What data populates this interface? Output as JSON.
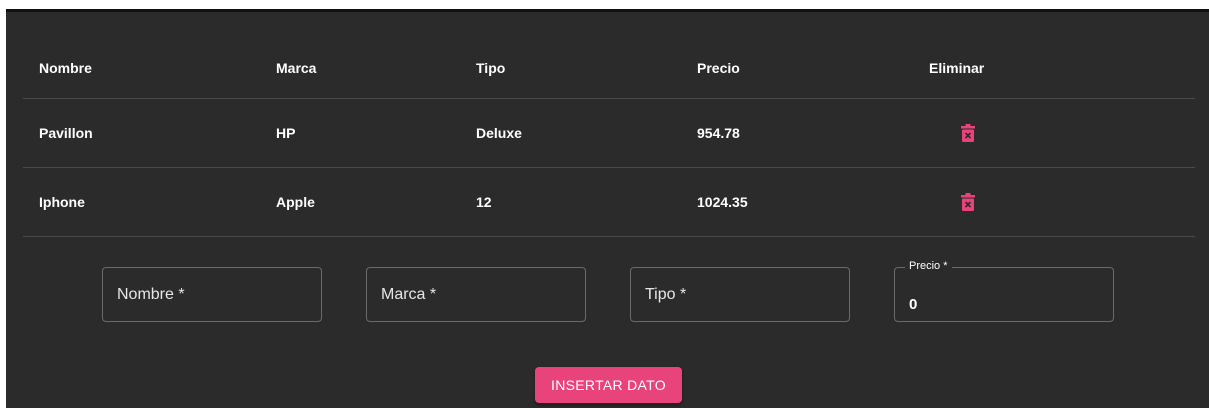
{
  "table": {
    "headers": {
      "nombre": "Nombre",
      "marca": "Marca",
      "tipo": "Tipo",
      "precio": "Precio",
      "eliminar": "Eliminar"
    },
    "rows": [
      {
        "nombre": "Pavillon",
        "marca": "HP",
        "tipo": "Deluxe",
        "precio": "954.78"
      },
      {
        "nombre": "Iphone",
        "marca": "Apple",
        "tipo": "12",
        "precio": "1024.35"
      }
    ],
    "delete_icon": "trash-icon",
    "delete_icon_color": "#e8437a"
  },
  "form": {
    "nombre_label": "Nombre *",
    "marca_label": "Marca *",
    "tipo_label": "Tipo *",
    "precio_label": "Precio *",
    "precio_value": "0"
  },
  "button": {
    "label": "INSERTAR DATO",
    "color": "#e8437a"
  }
}
